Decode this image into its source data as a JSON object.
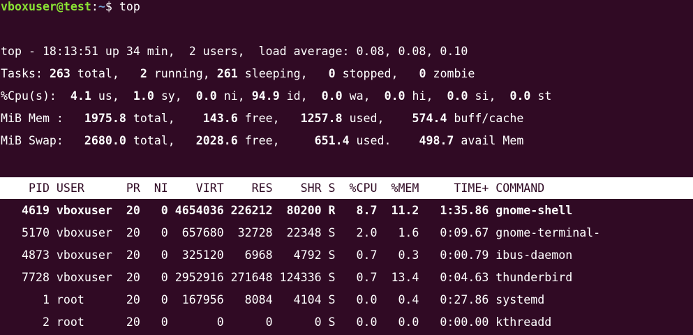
{
  "prompt": {
    "user_host": "vboxuser@test",
    "sep": ":",
    "path": "~",
    "symbol": "$",
    "command": "top"
  },
  "summary": {
    "l1_pre": "top - 18:13:51 up 34 min,  2 users,  load average: 0.08, 0.08, 0.10",
    "tasks": {
      "label": "Tasks: ",
      "total": "263",
      "t_total": " total,   ",
      "running": "2",
      "t_running": " running, ",
      "sleeping": "261",
      "t_sleeping": " sleeping,   ",
      "stopped": "0",
      "t_stopped": " stopped,   ",
      "zombie": "0",
      "t_zombie": " zombie"
    },
    "cpu": {
      "label": "%Cpu(s):  ",
      "us": "4.1",
      "t_us": " us,  ",
      "sy": "1.0",
      "t_sy": " sy,  ",
      "ni": "0.0",
      "t_ni": " ni, ",
      "id": "94.9",
      "t_id": " id,  ",
      "wa": "0.0",
      "t_wa": " wa,  ",
      "hi": "0.0",
      "t_hi": " hi,  ",
      "si": "0.0",
      "t_si": " si,  ",
      "st": "0.0",
      "t_st": " st"
    },
    "mem": {
      "label": "MiB Mem :   ",
      "total": "1975.8",
      "t_total": " total,    ",
      "free": "143.6",
      "t_free": " free,   ",
      "used": "1257.8",
      "t_used": " used,    ",
      "buff": "574.4",
      "t_buff": " buff/cache"
    },
    "swap": {
      "label": "MiB Swap:   ",
      "total": "2680.0",
      "t_total": " total,   ",
      "free": "2028.6",
      "t_free": " free,     ",
      "used": "651.4",
      "t_used": " used.    ",
      "avail": "498.7",
      "t_avail": " avail Mem"
    }
  },
  "table": {
    "header": "    PID USER      PR  NI    VIRT    RES    SHR S  %CPU  %MEM     TIME+ COMMAND",
    "rows": [
      "   4619 vboxuser  20   0 4654036 226212  80200 R   8.7  11.2   1:35.86 gnome-shell",
      "   5170 vboxuser  20   0  657680  32728  22348 S   2.0   1.6   0:09.67 gnome-terminal-",
      "   4873 vboxuser  20   0  325120   6968   4792 S   0.7   0.3   0:00.79 ibus-daemon",
      "   7728 vboxuser  20   0 2952916 271648 124336 S   0.7  13.4   0:04.63 thunderbird",
      "      1 root      20   0  167956   8084   4104 S   0.0   0.4   0:27.86 systemd",
      "      2 root      20   0       0      0      0 S   0.0   0.0   0:00.00 kthreadd"
    ]
  },
  "colors": {
    "background": "#300a24",
    "prompt_user": "#8ae234",
    "prompt_path": "#729fcf",
    "header_bg": "#ffffff"
  }
}
